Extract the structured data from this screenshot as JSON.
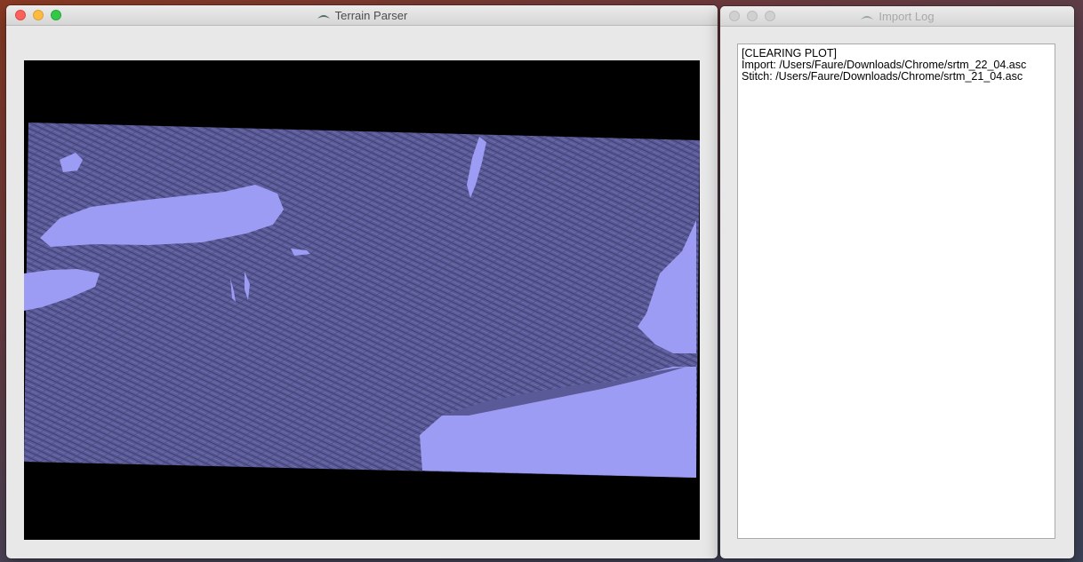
{
  "terrain_window": {
    "title": "Terrain Parser",
    "icon": "terrain-app-icon"
  },
  "log_window": {
    "title": "Import Log",
    "icon": "terrain-app-icon",
    "lines": [
      "[CLEARING PLOT]",
      "Import: /Users/Faure/Downloads/Chrome/srtm_22_04.asc",
      "Stitch: /Users/Faure/Downloads/Chrome/srtm_21_04.asc"
    ]
  },
  "colors": {
    "terrain": "#5a5a98",
    "water": "#9c9cf4",
    "plot_background": "#000000"
  }
}
